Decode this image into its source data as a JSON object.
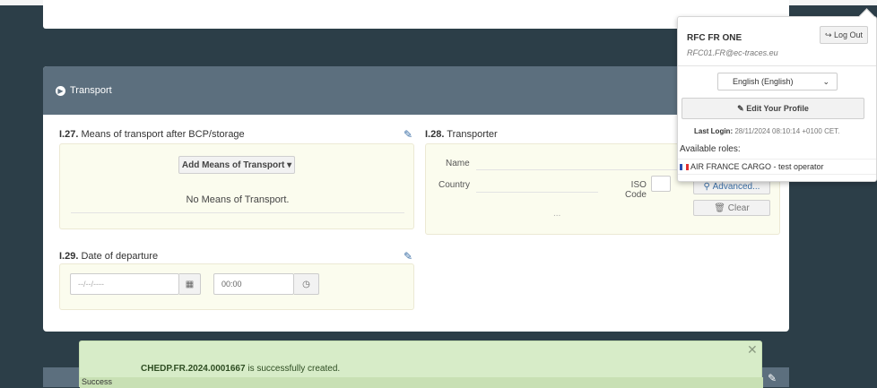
{
  "transport": {
    "header": "Transport",
    "means": {
      "code": "I.27.",
      "title": "Means of transport after BCP/storage",
      "add_button": "Add Means of Transport",
      "empty_text": "No Means of Transport."
    },
    "transporter": {
      "code": "I.28.",
      "title": "Transporter",
      "name_label": "Name",
      "country_label": "Country",
      "iso_label_1": "ISO",
      "iso_label_2": "Code",
      "advanced_button": "Advanced...",
      "clear_button": "Clear",
      "more": "..."
    },
    "departure": {
      "code": "I.29.",
      "title": "Date of departure",
      "date_placeholder": "--/--/----",
      "time_value": "00:00"
    }
  },
  "user_menu": {
    "name": "RFC FR ONE",
    "email": "RFC01.FR@ec-traces.eu",
    "logout": "Log Out",
    "language": "English (English)",
    "edit_profile": "Edit Your Profile",
    "last_login_label": "Last Login:",
    "last_login_value": "28/11/2024 08:10:14 +0100 CET.",
    "roles_label": "Available roles:",
    "role": "AIR FRANCE CARGO - test operator"
  },
  "notification": {
    "ref": "CHEDP.FR.2024.0001667",
    "message": " is successfully created.",
    "status": "Success"
  }
}
